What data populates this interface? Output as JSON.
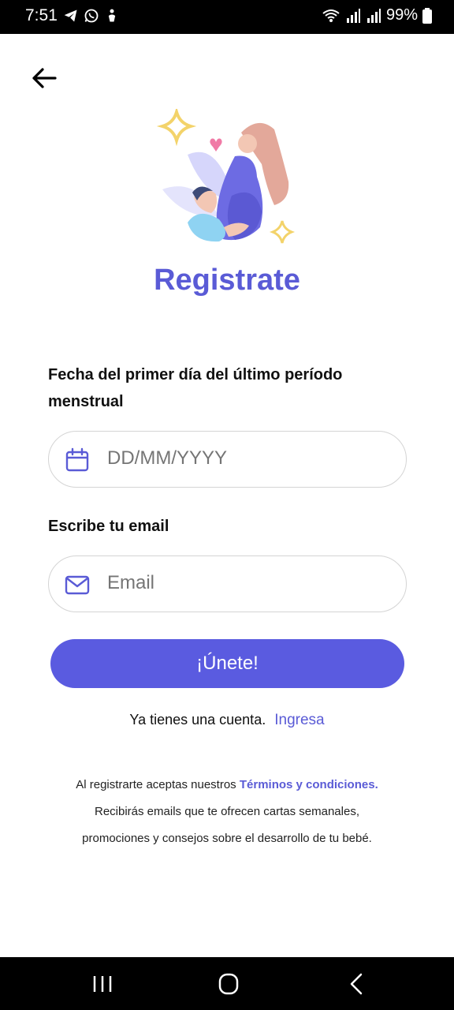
{
  "status_bar": {
    "time": "7:51",
    "battery": "99%",
    "icons": [
      "telegram-icon",
      "whatsapp-icon",
      "accessibility-icon",
      "wifi-icon",
      "signal-icon",
      "signal-icon",
      "battery-icon"
    ]
  },
  "header": {
    "back_icon": "arrow-left-icon"
  },
  "illustration": "pregnant-couple-illustration",
  "title": "Registrate",
  "form": {
    "date_label": "Fecha del primer día del último período menstrual",
    "date_placeholder": "DD/MM/YYYY",
    "date_icon": "calendar-icon",
    "email_label": "Escribe tu email",
    "email_placeholder": "Email",
    "email_icon": "mail-icon",
    "submit_label": "¡Únete!"
  },
  "login": {
    "prompt": "Ya tienes una cuenta.",
    "link": "Ingresa"
  },
  "legal": {
    "line1_prefix": "Al registrarte aceptas nuestros",
    "terms_link": "Términos y condiciones.",
    "line2": "Recibirás emails que te ofrecen cartas semanales,",
    "line3": "promociones y consejos sobre el desarrollo de tu bebé."
  },
  "colors": {
    "accent": "#5a5be0",
    "title": "#5a5bd6",
    "border": "#d4d4d4"
  },
  "nav_bar": {
    "buttons": [
      "recent-apps-icon",
      "home-icon",
      "back-icon"
    ]
  }
}
